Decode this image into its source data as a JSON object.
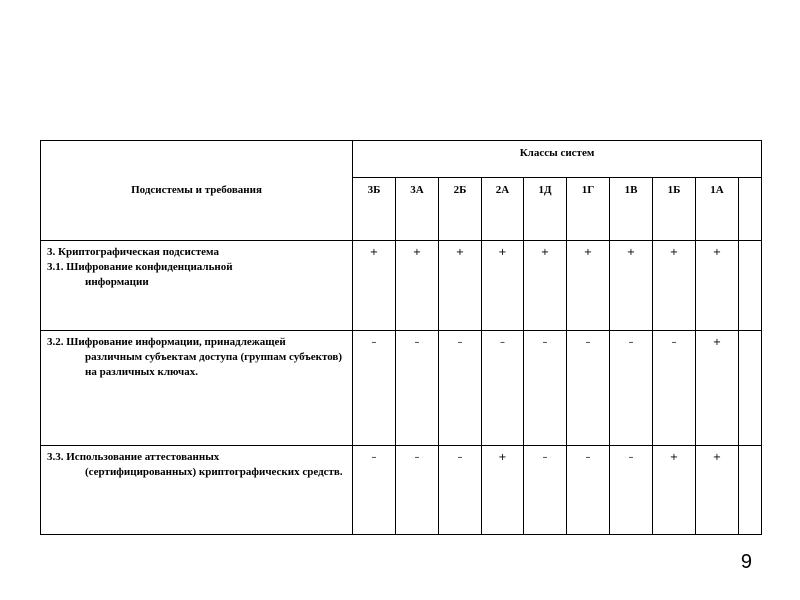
{
  "table": {
    "header": {
      "subsystems_label": "Подсистемы и требования",
      "classes_label": "Классы систем",
      "classes": [
        "3Б",
        "3А",
        "2Б",
        "2А",
        "1Д",
        "1Г",
        "1В",
        "1Б",
        "1А",
        ""
      ]
    },
    "rows": [
      {
        "title_line": "3. Криптографическая подсистема",
        "first_line": "3.1. Шифрование конфиденциальной",
        "rest": "информации",
        "marks": [
          "+",
          "+",
          "+",
          "+",
          "+",
          "+",
          "+",
          "+",
          "+",
          ""
        ]
      },
      {
        "title_line": "",
        "first_line": "3.2. Шифрование информации, принадлежащей",
        "rest": "различным субъектам доступа (группам субъектов) на различных ключах.",
        "marks": [
          "–",
          "–",
          "–",
          "–",
          "–",
          "–",
          "–",
          "–",
          "+",
          ""
        ]
      },
      {
        "title_line": "",
        "first_line": "3.3. Использование аттестованных",
        "rest": "(сертифицированных) криптографических средств.",
        "marks": [
          "–",
          "–",
          "–",
          "+",
          "–",
          "–",
          "–",
          "+",
          "+",
          ""
        ]
      }
    ]
  },
  "page_number": "9"
}
